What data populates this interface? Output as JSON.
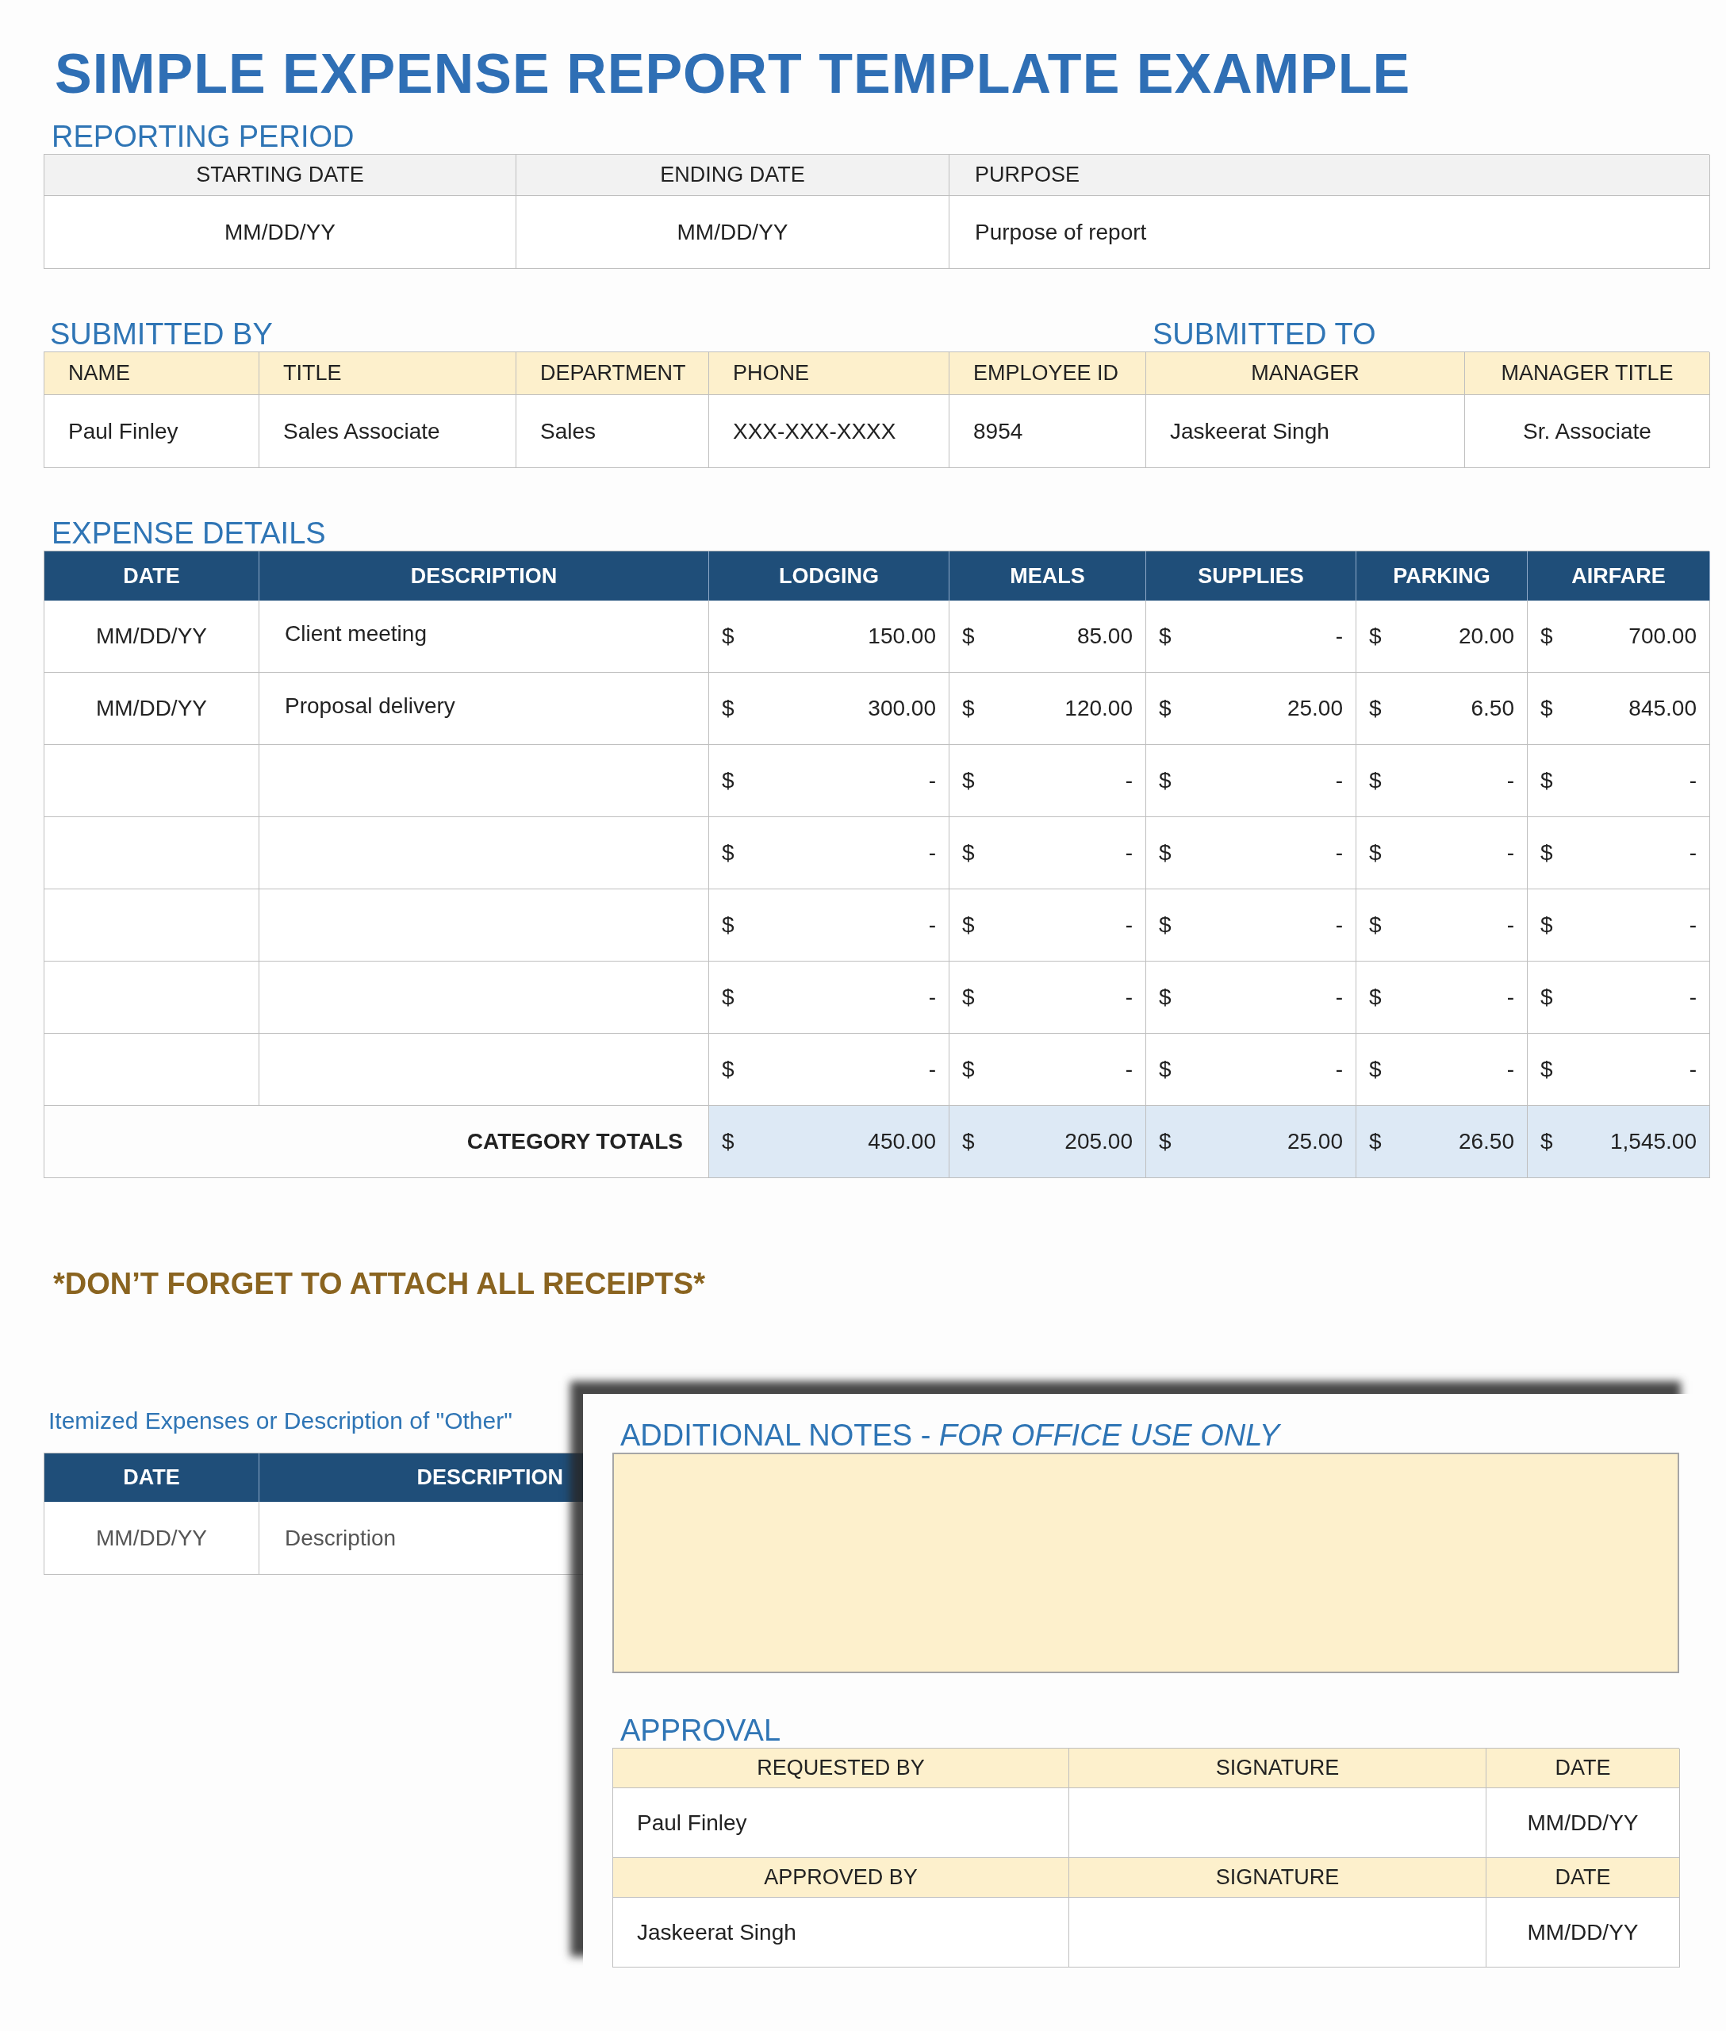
{
  "title": "SIMPLE EXPENSE REPORT TEMPLATE EXAMPLE",
  "reporting_period": {
    "label": "REPORTING PERIOD",
    "columns": [
      "STARTING DATE",
      "ENDING DATE",
      "PURPOSE"
    ],
    "values": [
      "MM/DD/YY",
      "MM/DD/YY",
      "Purpose of report"
    ]
  },
  "submitted_by": {
    "label": "SUBMITTED BY"
  },
  "submitted_to": {
    "label": "SUBMITTED TO"
  },
  "submission": {
    "columns": [
      "NAME",
      "TITLE",
      "DEPARTMENT",
      "PHONE",
      "EMPLOYEE ID",
      "MANAGER",
      "MANAGER TITLE"
    ],
    "values": [
      "Paul Finley",
      "Sales Associate",
      "Sales",
      "XXX-XXX-XXXX",
      "8954",
      "Jaskeerat Singh",
      "Sr. Associate"
    ]
  },
  "expense_details": {
    "label": "EXPENSE DETAILS",
    "columns": [
      "DATE",
      "DESCRIPTION",
      "LODGING",
      "MEALS",
      "SUPPLIES",
      "PARKING",
      "AIRFARE"
    ],
    "rows": [
      {
        "date": "MM/DD/YY",
        "description": "Client meeting",
        "amounts": [
          {
            "currency": "$",
            "value": "150.00"
          },
          {
            "currency": "$",
            "value": "85.00"
          },
          {
            "currency": "$",
            "value": "-"
          },
          {
            "currency": "$",
            "value": "20.00"
          },
          {
            "currency": "$",
            "value": "700.00"
          }
        ]
      },
      {
        "date": "MM/DD/YY",
        "description": "Proposal delivery",
        "amounts": [
          {
            "currency": "$",
            "value": "300.00"
          },
          {
            "currency": "$",
            "value": "120.00"
          },
          {
            "currency": "$",
            "value": "25.00"
          },
          {
            "currency": "$",
            "value": "6.50"
          },
          {
            "currency": "$",
            "value": "845.00"
          }
        ]
      },
      {
        "amounts": [
          {
            "currency": "$",
            "value": "-"
          },
          {
            "currency": "$",
            "value": "-"
          },
          {
            "currency": "$",
            "value": "-"
          },
          {
            "currency": "$",
            "value": "-"
          },
          {
            "currency": "$",
            "value": "-"
          }
        ]
      },
      {
        "amounts": [
          {
            "currency": "$",
            "value": "-"
          },
          {
            "currency": "$",
            "value": "-"
          },
          {
            "currency": "$",
            "value": "-"
          },
          {
            "currency": "$",
            "value": "-"
          },
          {
            "currency": "$",
            "value": "-"
          }
        ]
      },
      {
        "amounts": [
          {
            "currency": "$",
            "value": "-"
          },
          {
            "currency": "$",
            "value": "-"
          },
          {
            "currency": "$",
            "value": "-"
          },
          {
            "currency": "$",
            "value": "-"
          },
          {
            "currency": "$",
            "value": "-"
          }
        ]
      },
      {
        "amounts": [
          {
            "currency": "$",
            "value": "-"
          },
          {
            "currency": "$",
            "value": "-"
          },
          {
            "currency": "$",
            "value": "-"
          },
          {
            "currency": "$",
            "value": "-"
          },
          {
            "currency": "$",
            "value": "-"
          }
        ]
      },
      {
        "amounts": [
          {
            "currency": "$",
            "value": "-"
          },
          {
            "currency": "$",
            "value": "-"
          },
          {
            "currency": "$",
            "value": "-"
          },
          {
            "currency": "$",
            "value": "-"
          },
          {
            "currency": "$",
            "value": "-"
          }
        ]
      }
    ],
    "totals": {
      "label": "CATEGORY TOTALS",
      "amounts": [
        {
          "currency": "$",
          "value": "450.00"
        },
        {
          "currency": "$",
          "value": "205.00"
        },
        {
          "currency": "$",
          "value": "25.00"
        },
        {
          "currency": "$",
          "value": "26.50"
        },
        {
          "currency": "$",
          "value": "1,545.00"
        }
      ]
    }
  },
  "reminder": "*DON’T FORGET TO ATTACH ALL RECEIPTS*",
  "itemized": {
    "label": "Itemized Expenses or Description of \"Other\"",
    "columns": [
      "DATE",
      "DESCRIPTION"
    ],
    "rows": [
      {
        "date": "MM/DD/YY",
        "description": "Description"
      }
    ]
  },
  "office_panel": {
    "notes_label": "ADDITIONAL NOTES - *FOR OFFICE USE ONLY*",
    "approval": {
      "label": "APPROVAL",
      "sections": [
        {
          "columns": [
            "REQUESTED BY",
            "SIGNATURE",
            "DATE"
          ],
          "name": "Paul Finley",
          "date": "MM/DD/YY"
        },
        {
          "columns": [
            "APPROVED BY",
            "SIGNATURE",
            "DATE"
          ],
          "name": "Jaskeerat Singh",
          "date": "MM/DD/YY"
        }
      ]
    }
  }
}
